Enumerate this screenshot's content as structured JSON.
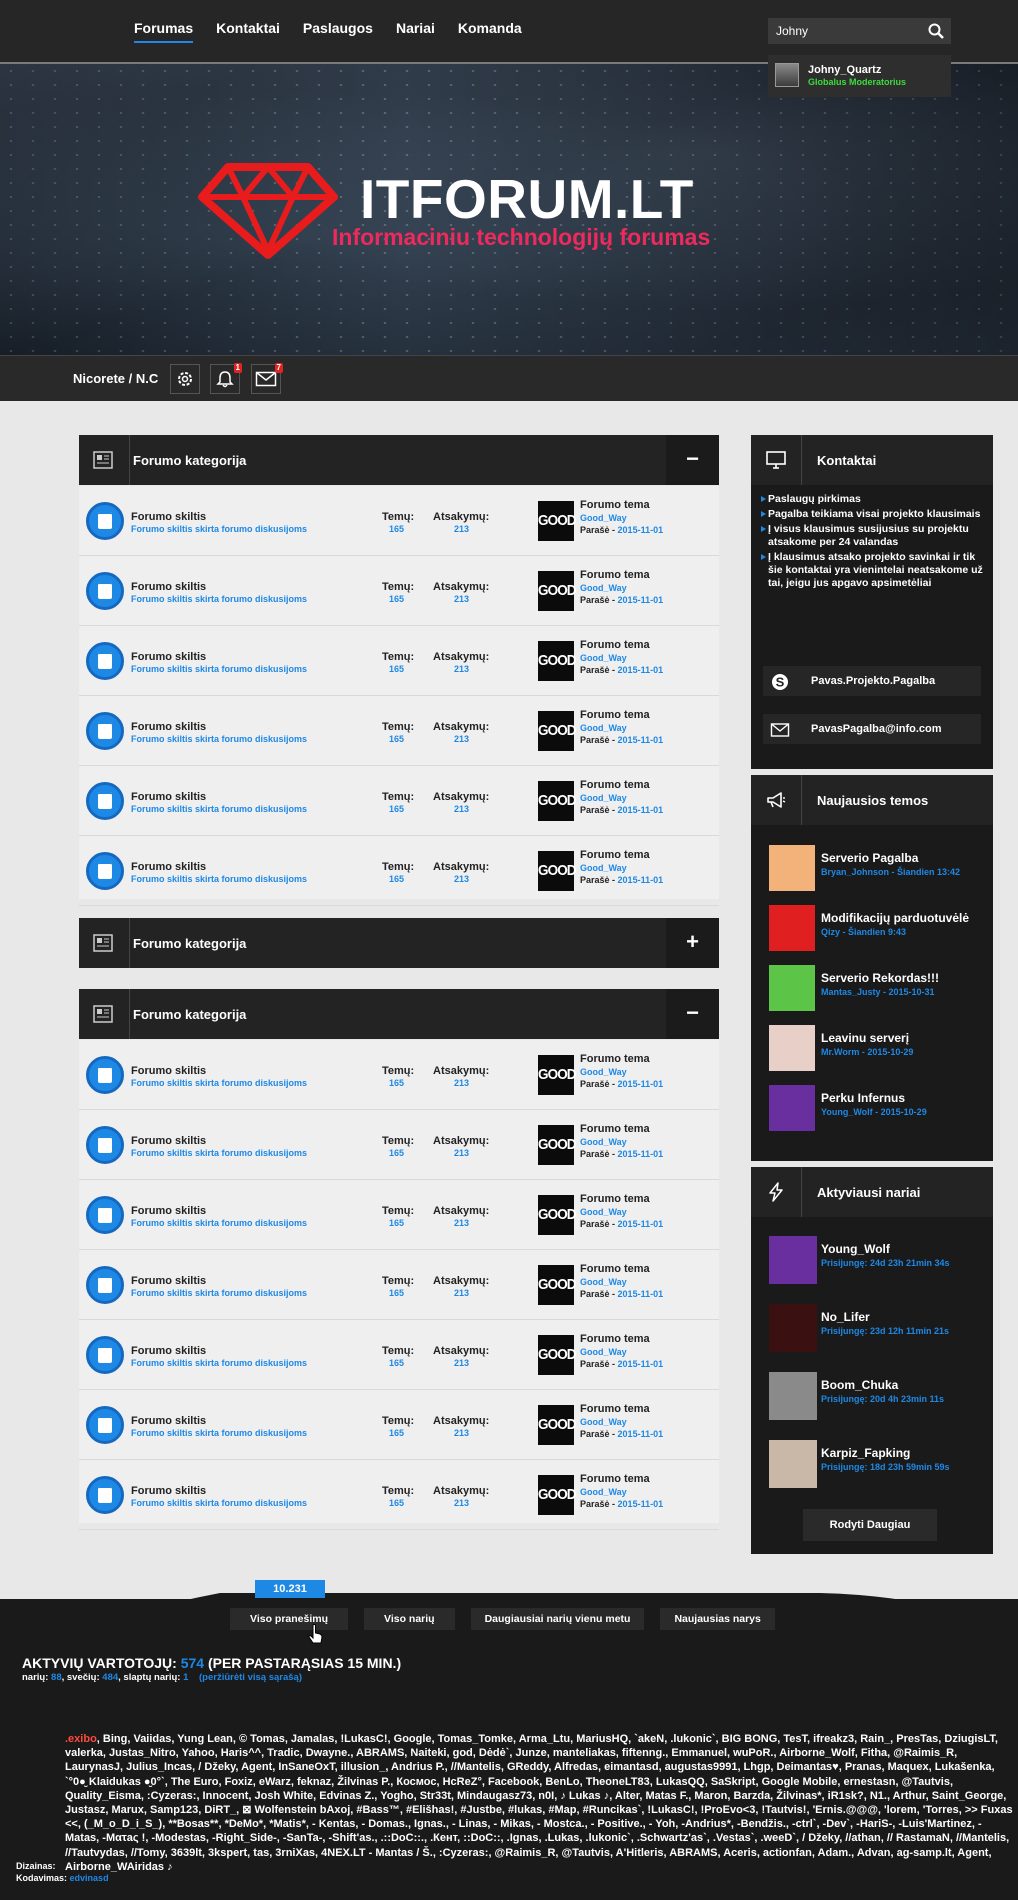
{
  "nav": {
    "links": [
      "Forumas",
      "Kontaktai",
      "Paslaugos",
      "Nariai",
      "Komanda"
    ],
    "search_value": "Johny",
    "suggestion": {
      "name": "Johny_Quartz",
      "role": "Globalus Moderatorius"
    }
  },
  "banner": {
    "title": "ITFORUM.LT",
    "subtitle": "Informaciniu technologijų forumas"
  },
  "userbar": {
    "username": "Nicorete / N.C",
    "notifications": "1",
    "messages": "7"
  },
  "categories": [
    {
      "title": "Forumo kategorija",
      "toggle": "−",
      "expanded": true
    },
    {
      "title": "Forumo kategorija",
      "toggle": "+",
      "expanded": false
    },
    {
      "title": "Forumo kategorija",
      "toggle": "−",
      "expanded": true
    }
  ],
  "forum_row": {
    "name": "Forumo skiltis",
    "desc": "Forumo skiltis skirta forumo diskusijoms",
    "topics_label": "Temų:",
    "topics": "165",
    "replies_label": "Atsakymų:",
    "replies": "213",
    "avatar_text": "GOOD",
    "last_title": "Forumo tema",
    "last_user": "Good_Way",
    "posted_label": "Parašė -",
    "last_date": "2015-11-01"
  },
  "sidebar": {
    "contacts": {
      "title": "Kontaktai",
      "items": [
        "Paslaugų pirkimas",
        "Pagalba teikiama visai projekto klausimais",
        "Į visus klausimus susijusius su projektu atsakome per 24 valandas",
        "Į klausimus atsako projekto savinkai ir tik šie kontaktai yra vienintelai neatsakome už tai, jeigu jus apgavo apsimetėliai"
      ],
      "skype": "Pavas.Projekto.Pagalba",
      "email": "PavasPagalba@info.com"
    },
    "news": {
      "title": "Naujausios temos",
      "items": [
        {
          "title": "Serverio Pagalba",
          "meta": "Bryan_Johnson - Šiandien 13:42",
          "avatar_color": "#f2b27a"
        },
        {
          "title": "Modifikacijų parduotuvėlė",
          "meta": "Qizy - Šiandien 9:43",
          "avatar_color": "#e02020"
        },
        {
          "title": "Serverio Rekordas!!!",
          "meta": "Mantas_Justy - 2015-10-31",
          "avatar_color": "#5cc447"
        },
        {
          "title": "Leavinu serverį",
          "meta": "Mr.Worm - 2015-10-29",
          "avatar_color": "#e8cfc7"
        },
        {
          "title": "Perku Infernus",
          "meta": "Young_Wolf - 2015-10-29",
          "avatar_color": "#6a2f9e"
        }
      ]
    },
    "active": {
      "title": "Aktyviausi nariai",
      "items": [
        {
          "name": "Young_Wolf",
          "meta": "Prisijungę: 24d 23h 21min 34s",
          "avatar_color": "#6a2f9e"
        },
        {
          "name": "No_Lifer",
          "meta": "Prisijungę: 23d 12h 11min 21s",
          "avatar_color": "#3a1010"
        },
        {
          "name": "Boom_Chuka",
          "meta": "Prisijungę: 20d 4h 23min 11s",
          "avatar_color": "#8a8a8a"
        },
        {
          "name": "Karpiz_Fapking",
          "meta": "Prisijungę: 18d 23h 59min 59s",
          "avatar_color": "#c9b8a8"
        }
      ],
      "more": "Rodyti Daugiau"
    }
  },
  "stats": {
    "count": "10.231",
    "tabs": [
      "Viso pranešimų",
      "Viso narių",
      "Daugiausiai narių vienu metu",
      "Naujausias narys"
    ]
  },
  "active_users": {
    "title_prefix": "AKTYVIŲ VARTOTOJŲ:",
    "count": "574",
    "title_suffix": "(PER PASTARĄSIAS 15 MIN.)",
    "members_label": "narių:",
    "members": "88",
    "guests_label": ", svečių:",
    "guests": "484",
    "hidden_label": ", slaptų narių:",
    "hidden": "1",
    "link": "(peržiūrėti visą sąrašą)",
    "first_user": ".exibo",
    "list": ", Bing, Vaiidas, Yung Lean, © Tomas, Jamalas, !LukasC!, Google, Tomas_Tomke, Arma_Ltu, MariusHQ, `akeN, .lukonic`, BIG BONG, TesT, ifreakz3, Rain_, PresTas, DziugisLT, valerka, Justas_Nitro, Yahoo, Haris^^, Tradic, Dwayne., ABRAMS, Naiteki, god, Dėdė`, Junze, manteliakas, fiftenng., Emmanuel, wuPoR., Airborne_Wolf, Fitha, @Raimis_R, LaurynasJ, Julius_Incas, / Džeky, Agent, InSaneOxT, illusion_, Andrius P., //Mantelis, GReddy, Alfredas, eimantasd, augustas9991, Lhgp, Deimantas♥, Pranas, Maquex, Lukašenka, `°0●̮ Klaidukas ●̮0°`, The Euro, Foxiz, eWarz, feknaz, Žilvinas P., Космос, HcReZ°, Facebook, BenLo, TheoneLT83, LukasQQ, SaSkript, Google Mobile, ernestasn, @Tautvis, Quality_Eisma, :Cyzeras:, Innocent, Josh White, Edvinas Z., Yogho, Str33t, Mindaugasz73, n0I, ♪ Lukas ♪, Alter, Matas F., Maron, Barzda, Žilvinas*, iR1sk?, N1., Arthur, Saint_George, Justasz, Marux, Samp123, DiRT_, ⊠ Wolfenstein bAxoj, #Bass™, #Elišhas!, #Justbe, #lukas, #Map, #Runcikas`, !LukasC!, !ProEvo<3, !Tautvis!, 'Ernis.@@@, 'lorem, 'Torres, >> Fuxas <<, (_M_o_D_i_S_), **Bosas**, *DeMo*, *Matis*, - Kentas, - Domas., Ignas., - Linas, - Mikas, - Mostca., - Positive., - Yoh, -Andrius*, -Bendžis., -ctrl`, -Dev`, -HariS-, -Luis'Martinez, -Matas, -Mατaς !, -Modestas, -Right_Side-, -SanTa-, -Shift'as., .::DoC::., .Кент, ::DoC::, .Ignas, .Lukas, .lukonic`, .Schwartz'as`, .Vestas`, .weeD`, / Džeky, //athan, // RastamaN, //Mantelis, //Tautvydas, //Tomy, 3639lt, 3kspert, tas, 3rniXas, 4NEX.LT - Mantas / Š., :Cyzeras:, @Raimis_R, @Tautvis, A'Hitleris, ABRAMS, Aceris, actionfan, Adam., Advan, ag-samp.lt, Agent, Airborne_WAiridas ♪"
  },
  "credits": {
    "design_label": "Dizainas:",
    "design": "",
    "code_label": "Kodavimas:",
    "code": "edvinasd"
  }
}
